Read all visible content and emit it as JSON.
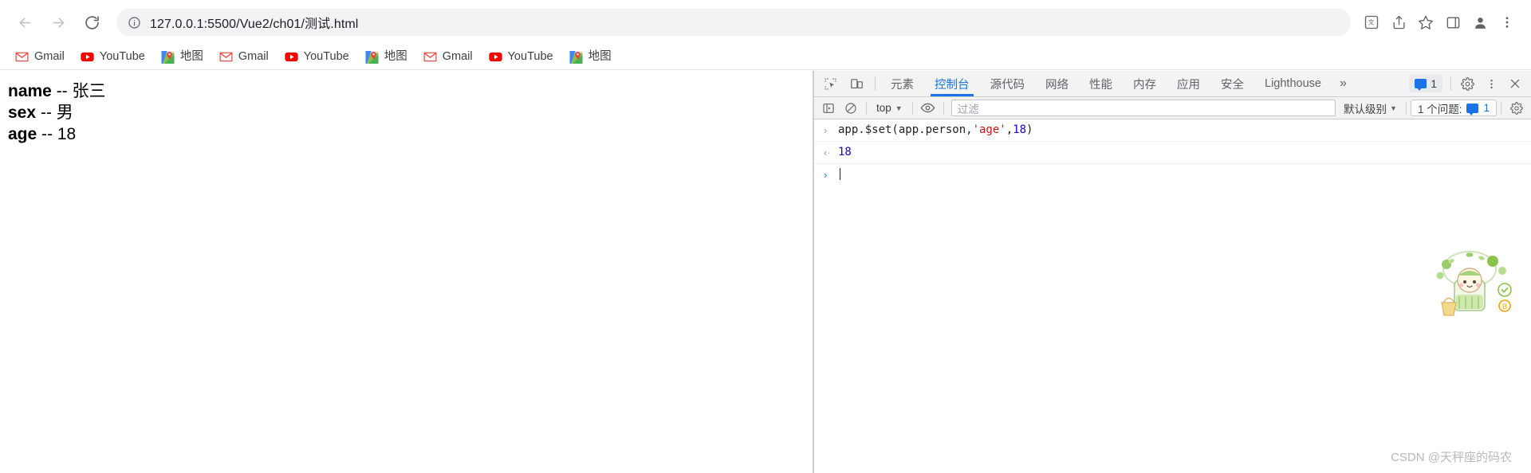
{
  "browser": {
    "nav": {
      "back_label": "Back",
      "forward_label": "Forward",
      "reload_label": "Reload"
    },
    "omnibox": {
      "url": "127.0.0.1:5500/Vue2/ch01/测试.html",
      "info_icon": "info-circle-icon"
    },
    "toolbar_icons": [
      {
        "name": "translate-icon",
        "label": "翻译"
      },
      {
        "name": "share-icon",
        "label": "分享"
      },
      {
        "name": "bookmark-star-icon",
        "label": "收藏"
      },
      {
        "name": "side-panel-icon",
        "label": "侧边栏"
      },
      {
        "name": "profile-avatar-icon",
        "label": "个人资料"
      },
      {
        "name": "chrome-menu-icon",
        "label": "自定义及控制"
      }
    ],
    "bookmarks": [
      {
        "label": "Gmail",
        "icon": "gmail-icon"
      },
      {
        "label": "YouTube",
        "icon": "youtube-icon"
      },
      {
        "label": "地图",
        "icon": "google-maps-icon"
      },
      {
        "label": "Gmail",
        "icon": "gmail-icon"
      },
      {
        "label": "YouTube",
        "icon": "youtube-icon"
      },
      {
        "label": "地图",
        "icon": "google-maps-icon"
      },
      {
        "label": "Gmail",
        "icon": "gmail-icon"
      },
      {
        "label": "YouTube",
        "icon": "youtube-icon"
      },
      {
        "label": "地图",
        "icon": "google-maps-icon"
      }
    ]
  },
  "page": {
    "lines": [
      {
        "key": "name",
        "sep": " -- ",
        "value": "张三"
      },
      {
        "key": "sex",
        "sep": " -- ",
        "value": "男"
      },
      {
        "key": "age",
        "sep": " -- ",
        "value": "18"
      }
    ]
  },
  "devtools": {
    "left_icons": [
      {
        "name": "inspect-element-icon"
      },
      {
        "name": "device-toolbar-icon"
      }
    ],
    "tabs": [
      {
        "label": "元素",
        "active": false
      },
      {
        "label": "控制台",
        "active": true
      },
      {
        "label": "源代码",
        "active": false
      },
      {
        "label": "网络",
        "active": false
      },
      {
        "label": "性能",
        "active": false
      },
      {
        "label": "内存",
        "active": false
      },
      {
        "label": "应用",
        "active": false
      },
      {
        "label": "安全",
        "active": false
      },
      {
        "label": "Lighthouse",
        "active": false
      }
    ],
    "more_tabs_label": "»",
    "issues_badge_count": "1",
    "right_icons": [
      {
        "name": "settings-gear-icon"
      },
      {
        "name": "more-options-icon"
      },
      {
        "name": "close-devtools-icon"
      }
    ],
    "console_toolbar": {
      "sidebar_toggle_icon": "console-sidebar-icon",
      "clear_console_icon": "clear-console-icon",
      "context_selector": "top",
      "eye_icon": "live-expression-icon",
      "filter_placeholder": "过滤",
      "level_selector": "默认级别",
      "issues_label": "1 个问题:",
      "issues_count": "1",
      "settings_icon": "console-settings-icon"
    },
    "console_entries": [
      {
        "type": "input",
        "marker": "›",
        "tokens": [
          {
            "text": "app.$set(app.person,",
            "cls": "plain"
          },
          {
            "text": "'age'",
            "cls": "tok-str"
          },
          {
            "text": ",",
            "cls": "plain"
          },
          {
            "text": "18",
            "cls": "tok-num"
          },
          {
            "text": ")",
            "cls": "plain"
          }
        ],
        "plain": "app.$set(app.person,'age',18)"
      },
      {
        "type": "output",
        "marker": "‹·",
        "plain": "18"
      },
      {
        "type": "prompt",
        "marker": "›",
        "plain": ""
      }
    ]
  },
  "watermark": {
    "text": "CSDN @天秤座的码农"
  },
  "colors": {
    "accent": "#1a73e8",
    "toolbar_bg": "#f3f3f3",
    "text": "#3c4043",
    "string_token": "#c41a16",
    "number_token": "#1c00cf"
  }
}
